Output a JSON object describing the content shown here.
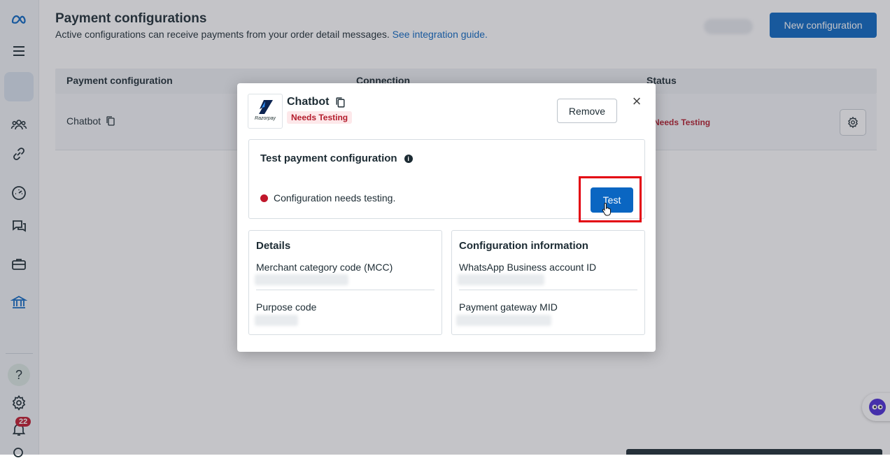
{
  "sidebar": {
    "icons": [
      "meta-logo-icon",
      "menu-icon",
      "workspace-icon",
      "people-icon",
      "link-icon",
      "gauge-icon",
      "chat-icon",
      "briefcase-icon",
      "bank-icon",
      "help-icon",
      "settings-icon",
      "bell-icon",
      "search-icon"
    ],
    "help_label": "?",
    "notifications_count": "22"
  },
  "page": {
    "title": "Payment configurations",
    "subtitle": "Active configurations can receive payments from your order detail messages.",
    "guide_link": "See integration guide.",
    "new_button": "New configuration"
  },
  "table": {
    "headers": [
      "Payment configuration",
      "Connection",
      "Status"
    ],
    "rows": [
      {
        "name": "Chatbot",
        "status": "Needs Testing"
      }
    ]
  },
  "modal": {
    "logo_text": "Razorpay",
    "title": "Chatbot",
    "badge": "Needs Testing",
    "remove_label": "Remove",
    "close_label": "×",
    "test_card": {
      "title": "Test payment configuration",
      "info": "i",
      "status": "Configuration needs testing.",
      "button": "Test"
    },
    "details": {
      "title": "Details",
      "field1": "Merchant category code (MCC)",
      "field2": "Purpose code"
    },
    "config_info": {
      "title": "Configuration information",
      "field1": "WhatsApp Business account ID",
      "field2": "Payment gateway MID"
    }
  },
  "colors": {
    "primary": "#0a66c2",
    "danger": "#c0172b",
    "highlight": "#e3000f"
  }
}
